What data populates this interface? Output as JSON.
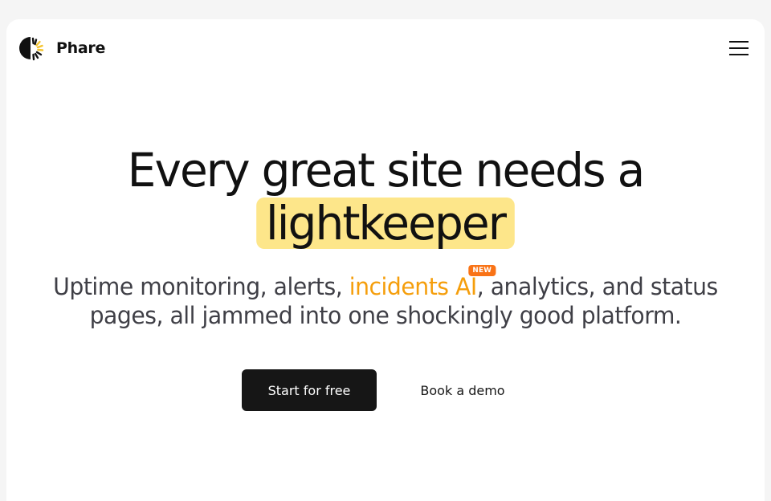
{
  "brand": {
    "name": "Phare",
    "icon": "lighthouse-beam-icon",
    "colors": {
      "dark": "#111111",
      "accent": "#f4c430"
    }
  },
  "nav": {
    "menu_icon": "hamburger-menu-icon"
  },
  "hero": {
    "headline_line1": "Every great site needs a",
    "headline_highlight": "lightkeeper",
    "subhead_part1": "Uptime monitoring, alerts, ",
    "subhead_accent": "incidents AI",
    "subhead_badge": "NEW",
    "subhead_part2": ", analytics, and status",
    "subhead_line2": "pages, all jammed into one shockingly good platform."
  },
  "cta": {
    "primary_label": "Start for free",
    "secondary_label": "Book a demo"
  },
  "colors": {
    "highlight_bg": "#fde68a",
    "accent_text": "#f59e0b",
    "badge_bg": "#f97316",
    "primary_button_bg": "#161616"
  }
}
